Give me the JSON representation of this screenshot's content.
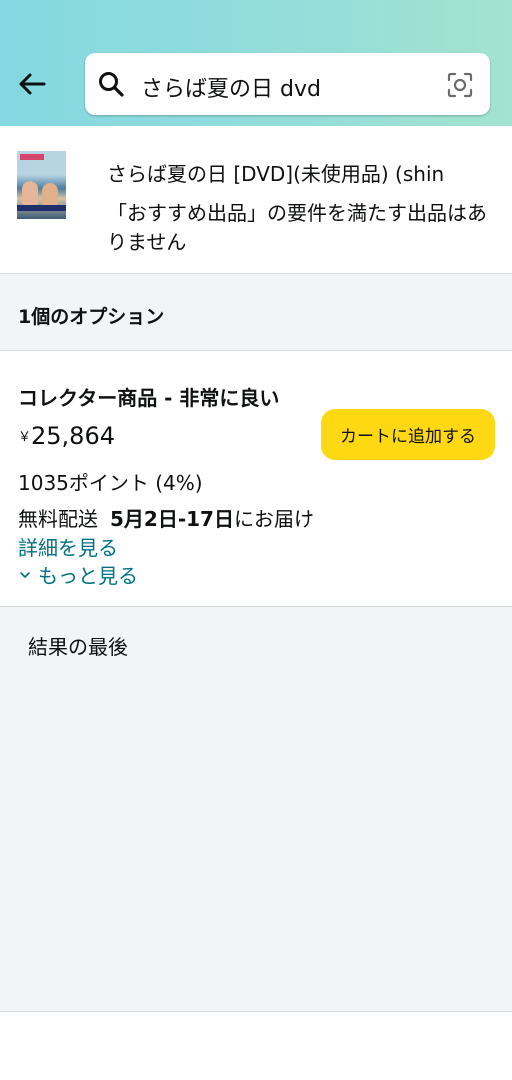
{
  "header": {
    "search_query": "さらば夏の日 dvd"
  },
  "product": {
    "title": "さらば夏の日 [DVD](未使用品) (shin",
    "note": "「おすすめ出品」の要件を満たす出品はありません"
  },
  "options": {
    "label": "1個のオプション"
  },
  "offer": {
    "condition": "コレクター商品 - 非常に良い",
    "currency_symbol": "￥",
    "price": "25,864",
    "add_to_cart_label": "カートに追加する",
    "points": "1035ポイント (4%)",
    "shipping_label": "無料配送",
    "delivery_dates": "5月2日-17日",
    "delivery_suffix": "にお届け",
    "details_link": "詳細を見る",
    "see_more": "もっと見る"
  },
  "results": {
    "end_label": "結果の最後"
  },
  "colors": {
    "add_to_cart_bg": "#ffd814",
    "link": "#007185",
    "section_bg": "#f1f5f7"
  }
}
